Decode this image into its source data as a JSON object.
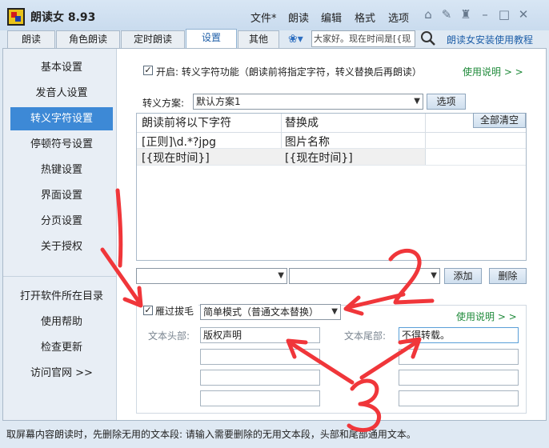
{
  "app": {
    "title": "朗读女 8.93"
  },
  "menu": [
    "文件*",
    "朗读",
    "编辑",
    "格式",
    "选项"
  ],
  "tabs": [
    "朗读",
    "角色朗读",
    "定时朗读",
    "设置",
    "其他"
  ],
  "active_tab": "设置",
  "search": {
    "value": "大家好。现在时间是[{现"
  },
  "install_link": "朗读女安装使用教程",
  "sidebar": {
    "items": [
      "基本设置",
      "发音人设置",
      "转义字符设置",
      "停顿符号设置",
      "热键设置",
      "界面设置",
      "分页设置",
      "关于授权"
    ],
    "active": "转义字符设置",
    "bottom_items": [
      "打开软件所在目录",
      "使用帮助",
      "检查更新",
      "访问官网 >>"
    ]
  },
  "escape": {
    "enable_checked": true,
    "enable_label": "开启: 转义字符功能（朗读前将指定字符，转义替换后再朗读）",
    "help_link": "使用说明 > >",
    "scheme_label": "转义方案:",
    "scheme_value": "默认方案1",
    "options_button": "选项",
    "clear_all_button": "全部清空",
    "columns": [
      "朗读前将以下字符",
      "替换成"
    ],
    "rows": [
      [
        "[正则]\\d.*?jpg",
        "图片名称"
      ],
      [
        "[{现在时间}]",
        "[{现在时间}]"
      ]
    ],
    "add_button": "添加",
    "delete_button": "删除"
  },
  "filter": {
    "checked": true,
    "label": "雁过拔毛",
    "mode_value": "简单模式（普通文本替换）",
    "help_link": "使用说明 > >",
    "head_label": "文本头部:",
    "tail_label": "文本尾部:",
    "head_values": [
      "版权声明",
      "",
      "",
      ""
    ],
    "tail_values": [
      "不得转载。",
      "",
      "",
      ""
    ]
  },
  "status": "取屏幕内容朗读时，先删除无用的文本段: 请输入需要删除的无用文本段，头部和尾部通用文本。",
  "annotations": [
    "1",
    "2",
    "3"
  ],
  "colors": {
    "accent": "#3d89d6",
    "link_green": "#1f8a3a",
    "link_blue": "#1f5fa8",
    "arrow_red": "#f0363a"
  }
}
